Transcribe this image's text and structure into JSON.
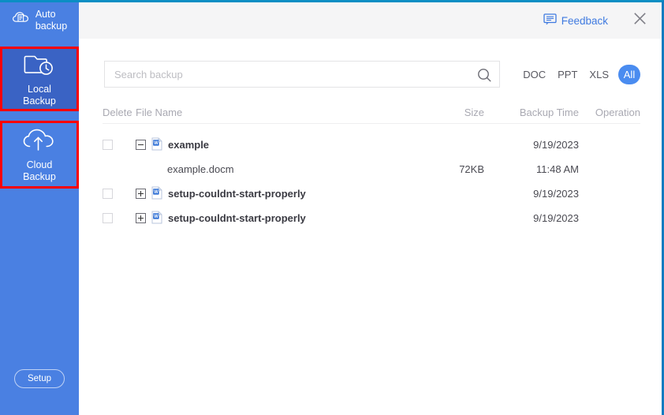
{
  "window": {
    "border_color": "#0f7cc0",
    "sidebar_color": "#4a80e2",
    "accent_color": "#4a8cf0",
    "highlight_color": "#ff0000"
  },
  "sidebar": {
    "items": [
      {
        "id": "auto-backup",
        "label_line1": "Auto",
        "label_line2": "backup",
        "icon": "cloud-document-icon",
        "selected": false,
        "highlighted": false
      },
      {
        "id": "local-backup",
        "label_line1": "Local",
        "label_line2": "Backup",
        "icon": "folder-clock-icon",
        "selected": true,
        "highlighted": true
      },
      {
        "id": "cloud-backup",
        "label_line1": "Cloud",
        "label_line2": "Backup",
        "icon": "cloud-upload-icon",
        "selected": false,
        "highlighted": true
      }
    ],
    "setup_label": "Setup"
  },
  "header": {
    "feedback_label": "Feedback",
    "feedback_icon": "speech-bubble-icon",
    "close_icon": "close-icon"
  },
  "search": {
    "placeholder": "Search backup",
    "value": "",
    "icon": "search-icon"
  },
  "filters": {
    "options": [
      {
        "label": "DOC",
        "active": false
      },
      {
        "label": "PPT",
        "active": false
      },
      {
        "label": "XLS",
        "active": false
      },
      {
        "label": "All",
        "active": true
      }
    ]
  },
  "table": {
    "columns": [
      "Delete",
      "File Name",
      "Size",
      "Backup Time",
      "Operation"
    ],
    "rows": [
      {
        "type": "group",
        "expanded": true,
        "checked": false,
        "icon": "word-document-icon",
        "name": "example",
        "size": "",
        "time": "9/19/2023",
        "operation": ""
      },
      {
        "type": "child",
        "expanded": null,
        "checked": null,
        "icon": "",
        "name": "example.docm",
        "size": "72KB",
        "time": "11:48 AM",
        "operation": ""
      },
      {
        "type": "group",
        "expanded": false,
        "checked": false,
        "icon": "word-document-icon",
        "name": "setup-couldnt-start-properly",
        "size": "",
        "time": "9/19/2023",
        "operation": ""
      },
      {
        "type": "group",
        "expanded": false,
        "checked": false,
        "icon": "word-document-icon",
        "name": "setup-couldnt-start-properly",
        "size": "",
        "time": "9/19/2023",
        "operation": ""
      }
    ]
  }
}
